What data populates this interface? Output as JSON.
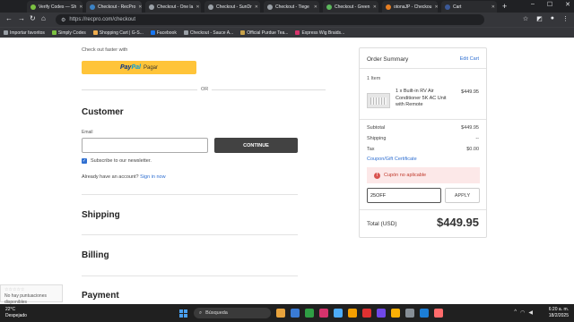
{
  "browser": {
    "tabs": [
      {
        "label": "Verify Codes — Sh",
        "color": "#7cc242",
        "active": false
      },
      {
        "label": "Checkout - RecPro",
        "color": "#3b82c4",
        "active": true
      },
      {
        "label": "Checkout - One la",
        "color": "#9aa0a6",
        "active": false
      },
      {
        "label": "Checkout - SunDr",
        "color": "#9aa0a6",
        "active": false
      },
      {
        "label": "Checkout - Tiege",
        "color": "#9aa0a6",
        "active": false
      },
      {
        "label": "Checkout - Green",
        "color": "#5cb85c",
        "active": false
      },
      {
        "label": "otonaJP - Checkou",
        "color": "#e67e22",
        "active": false
      },
      {
        "label": "Cart",
        "color": "#3b5998",
        "active": false
      }
    ],
    "url": "https://recpro.com/checkout",
    "bookmarks": [
      {
        "label": "Importar favoritos",
        "color": "#9aa0a6"
      },
      {
        "label": "Simply Codes",
        "color": "#7cc242"
      },
      {
        "label": "Shopping Cart | G-S...",
        "color": "#f0ad4e"
      },
      {
        "label": "Facebook",
        "color": "#1877f2"
      },
      {
        "label": "Checkout - Sauce A...",
        "color": "#9aa0a6"
      },
      {
        "label": "Official Purdue Tea...",
        "color": "#c8a24a"
      },
      {
        "label": "Express Wig Braids...",
        "color": "#d6336c"
      }
    ]
  },
  "checkout": {
    "faster_label": "Check out faster with",
    "paypal_logo_pay": "Pay",
    "paypal_logo_pal": "Pal",
    "paypal_text": "Pagar",
    "or_text": "OR",
    "customer_title": "Customer",
    "email_label": "Email",
    "email_value": "",
    "continue_label": "CONTINUE",
    "newsletter_label": "Subscribe to our newsletter.",
    "have_account_text": "Already have an account?",
    "sign_in_label": "Sign in now",
    "shipping_title": "Shipping",
    "billing_title": "Billing",
    "payment_title": "Payment"
  },
  "summary": {
    "title": "Order Summary",
    "edit_cart_label": "Edit Cart",
    "items_count": "1 Item",
    "product_name": "1 x Built-in RV Air Conditioner 5K AC Unit with Remote",
    "product_price": "$449.95",
    "subtotal_label": "Subtotal",
    "subtotal_value": "$449.95",
    "shipping_label": "Shipping",
    "shipping_value": "--",
    "tax_label": "Tax",
    "tax_value": "$0.00",
    "coupon_link": "Coupon/Gift Certificate",
    "coupon_error": "Cupón no aplicable",
    "coupon_value": "25OFF",
    "apply_label": "APPLY",
    "total_label": "Total (USD)",
    "total_value": "$449.95"
  },
  "recaptcha": {
    "stars": "☆☆☆☆☆",
    "text": "No hay puntuaciones disponibles"
  },
  "taskbar": {
    "temp": "22°C",
    "weather": "Despejado",
    "search_label": "Búsqueda",
    "time": "6:20 a. m.",
    "date": "18/2/2025",
    "apps": [
      "#e8a33d",
      "#3a7bd5",
      "#2f9e44",
      "#d6336c",
      "#4dabf7",
      "#f59f00",
      "#e03131",
      "#7048e8",
      "#fab005",
      "#868e96",
      "#1c7ed6",
      "#ff6b6b"
    ]
  }
}
